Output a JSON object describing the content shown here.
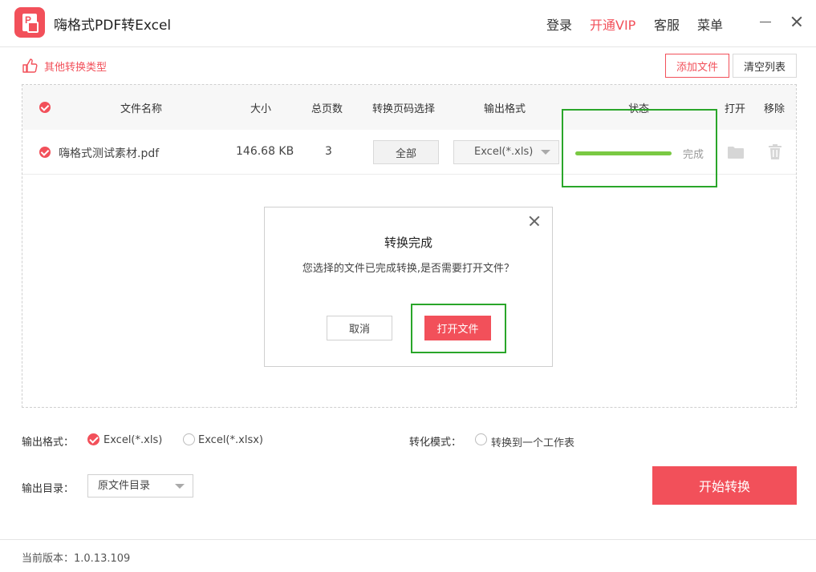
{
  "app": {
    "title": "嗨格式PDF转Excel",
    "logo_letter": "P"
  },
  "top_menu": {
    "login": "登录",
    "vip": "开通VIP",
    "service": "客服",
    "menu": "菜单"
  },
  "toolbar": {
    "other_types": "其他转换类型",
    "add_file": "添加文件",
    "clear_list": "清空列表"
  },
  "table": {
    "headers": {
      "file_name": "文件名称",
      "size": "大小",
      "pages": "总页数",
      "page_select": "转换页码选择",
      "output_format": "输出格式",
      "status": "状态",
      "open": "打开",
      "remove": "移除"
    },
    "rows": [
      {
        "checked": true,
        "file_name": "嗨格式测试素材.pdf",
        "size": "146.68 KB",
        "pages": "3",
        "page_select": "全部",
        "output_format": "Excel(*.xls)",
        "progress": 1.0,
        "status": "完成"
      }
    ]
  },
  "dialog": {
    "title": "转换完成",
    "message": "您选择的文件已完成转换,是否需要打开文件？",
    "cancel": "取消",
    "open_file": "打开文件"
  },
  "options": {
    "output_format_label": "输出格式：",
    "format_xls": "Excel(*.xls)",
    "format_xlsx": "Excel(*.xlsx)",
    "selected_format": "xls",
    "mode_label": "转化模式：",
    "mode_single_sheet": "转换到一个工作表",
    "mode_single_sheet_checked": false,
    "output_dir_label": "输出目录：",
    "output_dir_value": "原文件目录"
  },
  "actions": {
    "start": "开始转换"
  },
  "footer": {
    "version": "当前版本：1.0.13.109"
  },
  "colors": {
    "accent": "#f2505a",
    "progress": "#7ac943",
    "highlight": "#2aa62a"
  }
}
